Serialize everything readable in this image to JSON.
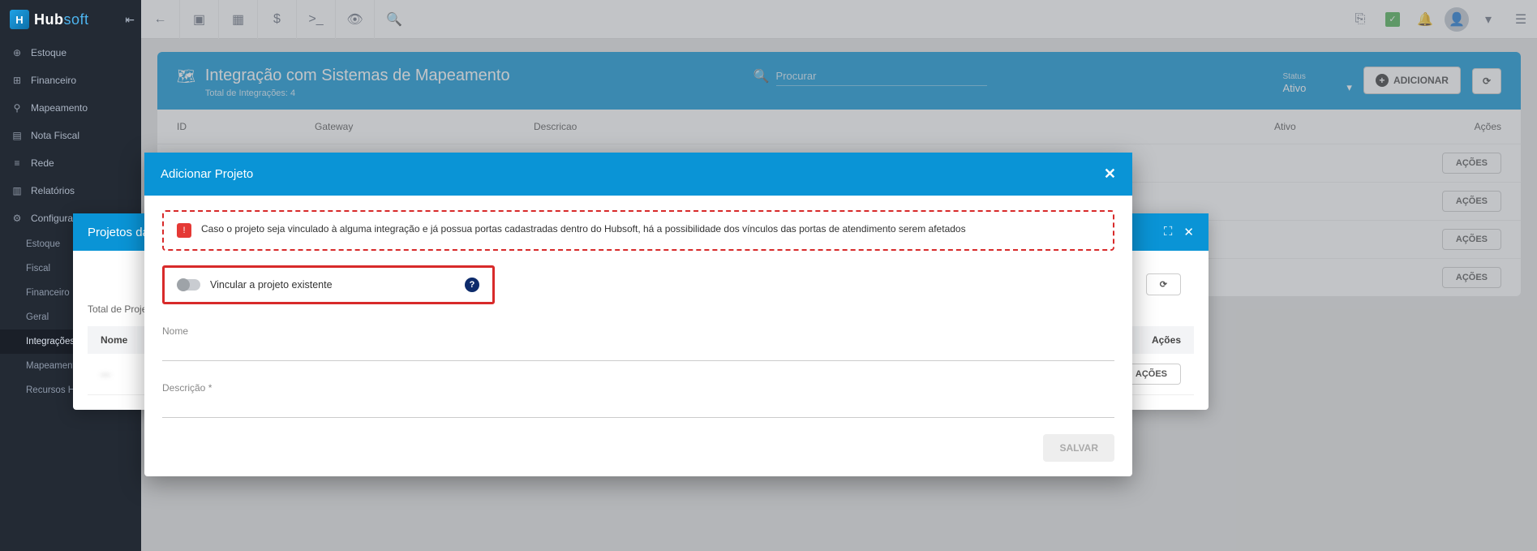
{
  "brand": {
    "name": "Hub",
    "suffix": "soft"
  },
  "sidebar": {
    "items": [
      {
        "icon": "⊕",
        "label": "Estoque"
      },
      {
        "icon": "⊞",
        "label": "Financeiro"
      },
      {
        "icon": "⚲",
        "label": "Mapeamento"
      },
      {
        "icon": "▤",
        "label": "Nota Fiscal"
      },
      {
        "icon": "≡",
        "label": "Rede"
      },
      {
        "icon": "▥",
        "label": "Relatórios"
      },
      {
        "icon": "⚙",
        "label": "Configuraçõ"
      }
    ],
    "subitems": [
      {
        "label": "Estoque"
      },
      {
        "label": "Fiscal"
      },
      {
        "label": "Financeiro"
      },
      {
        "label": "Geral"
      },
      {
        "label": "Integrações",
        "active": true
      },
      {
        "label": "Mapeamento"
      },
      {
        "label": "Recursos Humanos"
      }
    ]
  },
  "page": {
    "title": "Integração com Sistemas de Mapeamento",
    "subtitle": "Total de Integrações: 4",
    "search_placeholder": "Procurar",
    "status_label": "Status",
    "status_value": "Ativo",
    "add_btn": "ADICIONAR",
    "columns": {
      "id": "ID",
      "gateway": "Gateway",
      "descricao": "Descricao",
      "ativo": "Ativo",
      "acoes": "Ações"
    },
    "action_btn": "AÇÕES"
  },
  "panel_b": {
    "title": "Projetos da",
    "subtitle": "Total de Proje",
    "col_nome": "Nome",
    "col_acoes": "Ações",
    "row_btn": "AÇÕES",
    "blur_text": "—"
  },
  "modal": {
    "title": "Adicionar Projeto",
    "alert": "Caso o projeto seja vinculado à alguma integração e já possua portas cadastradas dentro do Hubsoft, há a possibilidade dos vínculos das portas de atendimento serem afetados",
    "toggle_label": "Vincular a projeto existente",
    "field_nome": "Nome",
    "field_descricao": "Descrição",
    "save": "SALVAR"
  }
}
